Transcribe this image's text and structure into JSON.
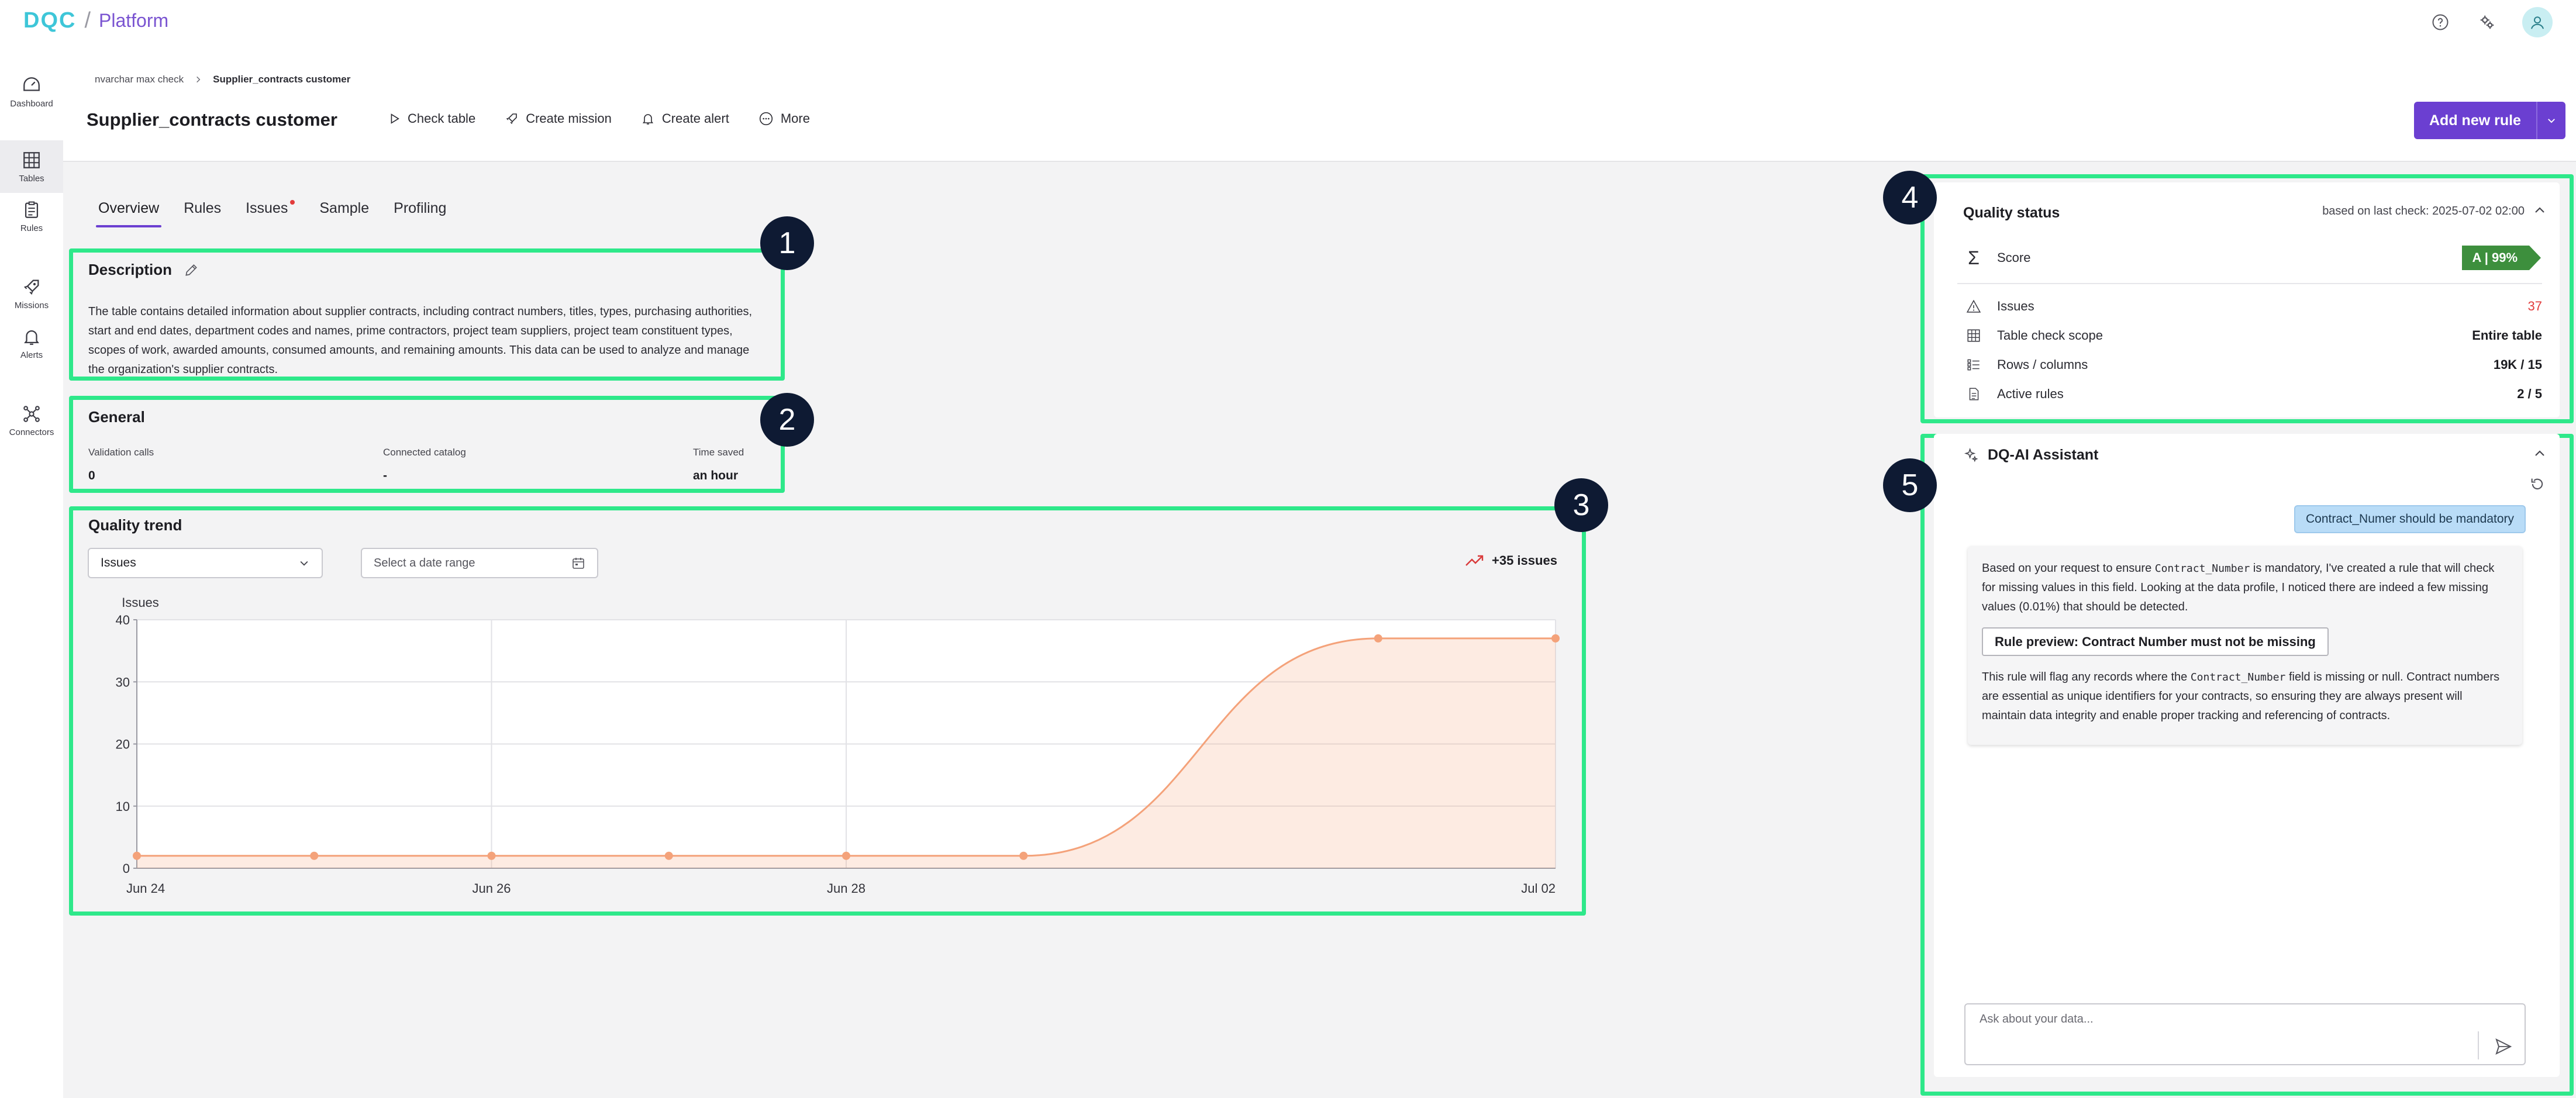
{
  "app": {
    "logo_mark": "DQC",
    "logo_sep": "/",
    "logo_text": "Platform"
  },
  "top_icons": [
    "help-icon",
    "settings-icon",
    "user-avatar-icon"
  ],
  "rail": {
    "items": [
      {
        "label": "Dashboard",
        "icon": "dashboard-icon"
      },
      {
        "label": "Tables",
        "icon": "table-grid-icon",
        "active": true
      },
      {
        "label": "Rules",
        "icon": "clipboard-icon"
      },
      {
        "label": "Missions",
        "icon": "rocket-icon"
      },
      {
        "label": "Alerts",
        "icon": "bell-icon"
      },
      {
        "label": "Connectors",
        "icon": "connectors-icon"
      }
    ]
  },
  "breadcrumb": {
    "parent": "nvarchar max check",
    "current": "Supplier_contracts customer"
  },
  "page": {
    "title": "Supplier_contracts customer"
  },
  "actions": {
    "check_table": "Check table",
    "create_mission": "Create mission",
    "create_alert": "Create alert",
    "more": "More",
    "add_new_rule": "Add new rule"
  },
  "tabs": [
    {
      "label": "Overview",
      "active": true
    },
    {
      "label": "Rules"
    },
    {
      "label": "Issues",
      "has_dot": true
    },
    {
      "label": "Sample"
    },
    {
      "label": "Profiling"
    }
  ],
  "markers": [
    "1",
    "2",
    "3",
    "4",
    "5"
  ],
  "description": {
    "title": "Description",
    "text": "The table contains detailed information about supplier contracts, including contract numbers, titles, types, purchasing authorities, start and end dates, department codes and names, prime contractors, project team suppliers, project team constituent types, scopes of work, awarded amounts, consumed amounts, and remaining amounts. This data can be used to analyze and manage the organization's supplier contracts."
  },
  "general": {
    "title": "General",
    "validation_calls_label": "Validation calls",
    "validation_calls_value": "0",
    "connected_catalog_label": "Connected catalog",
    "connected_catalog_value": "-",
    "time_saved_label": "Time saved",
    "time_saved_value": "an hour"
  },
  "quality_trend": {
    "title": "Quality trend",
    "metric_select_value": "Issues",
    "date_range_placeholder": "Select a date range",
    "trend_badge": "+35 issues"
  },
  "chart_data": {
    "type": "area",
    "ylabel": "Issues",
    "ylim": [
      0,
      40
    ],
    "yticks": [
      0,
      10,
      20,
      30,
      40
    ],
    "xtick_labels": [
      "Jun 24",
      "Jun 26",
      "Jun 28",
      "Jul 02"
    ],
    "xtick_positions_days": [
      0,
      2,
      4,
      8
    ],
    "x_days": [
      0,
      1,
      2,
      3,
      4,
      5,
      7,
      8
    ],
    "x": [
      "Jun 24",
      "Jun 25",
      "Jun 26",
      "Jun 27",
      "Jun 28",
      "Jun 29",
      "Jul 01",
      "Jul 02"
    ],
    "values": [
      2,
      2,
      2,
      2,
      2,
      2,
      37,
      37
    ],
    "grid": true,
    "color": "#f4a27a"
  },
  "quality_status": {
    "title": "Quality status",
    "last_check": "based on last check: 2025-07-02 02:00",
    "score_label": "Score",
    "score_value": "A | 99%",
    "issues_label": "Issues",
    "issues_value": "37",
    "scope_label": "Table check scope",
    "scope_value": "Entire table",
    "rows_label": "Rows / columns",
    "rows_value": "19K / 15",
    "active_rules_label": "Active rules",
    "active_rules_value": "2 / 5"
  },
  "ai_assistant": {
    "title": "DQ-AI Assistant",
    "user_message": "Contract_Numer should be mandatory",
    "msg_part1": "Based on your request to ensure ",
    "msg_code1": "Contract_Number",
    "msg_part2": " is mandatory, I've created a rule that will check for missing values in this field. Looking at the data profile, I noticed there are indeed a few missing values (0.01%) that should be detected.",
    "rule_preview": "Rule preview: Contract Number must not be missing",
    "msg_part3": "This rule will flag any records where the ",
    "msg_code2": "Contract_Number",
    "msg_part4": " field is missing or null. Contract numbers are essential as unique identifiers for your contracts, so ensuring they are always present will maintain data integrity and enable proper tracking and referencing of contracts.",
    "input_placeholder": "Ask about your data..."
  },
  "colors": {
    "accent": "#6b3fd1",
    "highlight_frame": "#2ee88a",
    "score_green": "#3d8f3d",
    "issues_red": "#e23b3b",
    "chart_line": "#f4a27a"
  }
}
